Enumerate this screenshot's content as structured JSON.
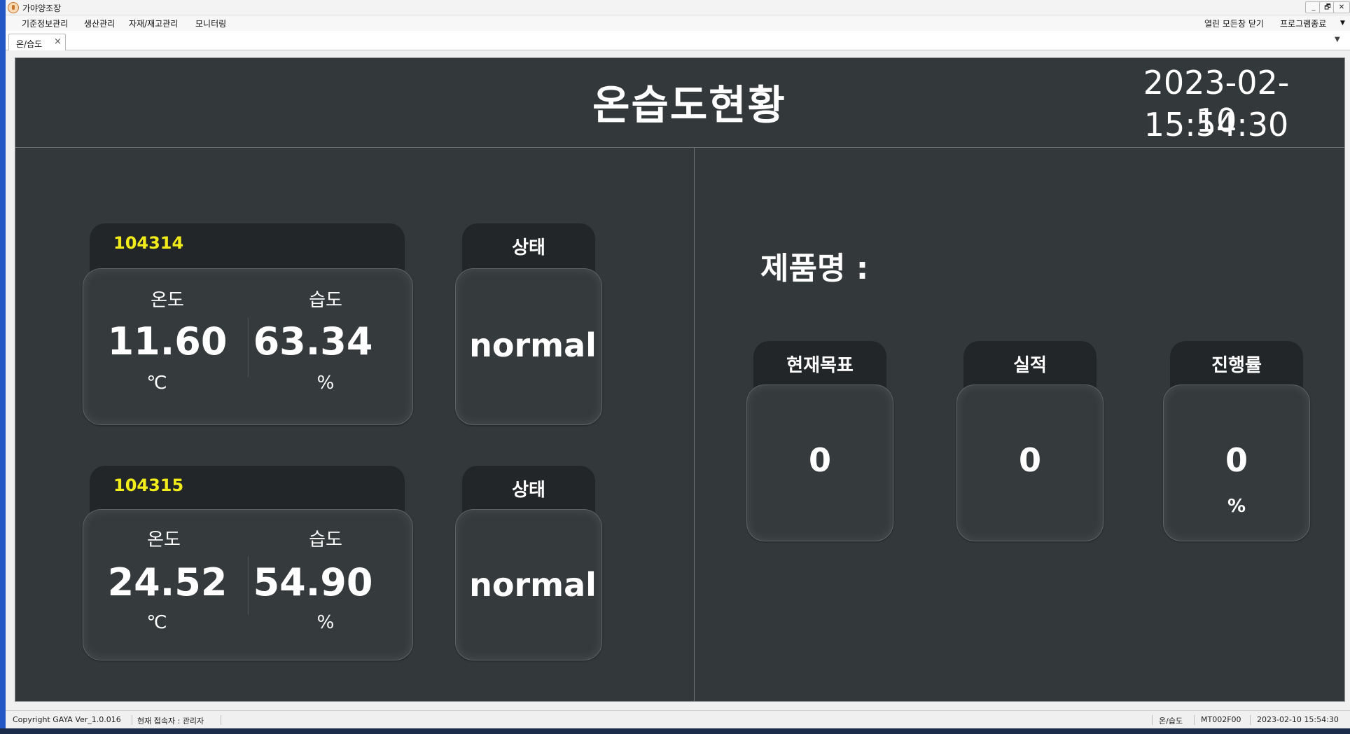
{
  "app": {
    "window_title": "가야양조장",
    "menu": [
      "기준정보관리",
      "생산관리",
      "자재/재고관리",
      "모니터링"
    ],
    "menu_right": [
      "열린 모든창 닫기",
      "프로그램종료"
    ],
    "window_buttons": [
      "_",
      "🗗",
      "✕"
    ]
  },
  "tab": {
    "label": "온/습도",
    "close": "×",
    "menu_arrow": "▼"
  },
  "dashboard": {
    "title": "온습도현황",
    "date": "2023-02-10",
    "time": "15:54:30"
  },
  "sensors": [
    {
      "id": "104314",
      "temp_label": "온도",
      "humidity_label": "습도",
      "temperature": "11.60",
      "humidity": "63.34",
      "temp_unit": "℃",
      "humidity_unit": "%",
      "status_label": "상태",
      "status": "normal"
    },
    {
      "id": "104315",
      "temp_label": "온도",
      "humidity_label": "습도",
      "temperature": "24.52",
      "humidity": "54.90",
      "temp_unit": "℃",
      "humidity_unit": "%",
      "status_label": "상태",
      "status": "normal"
    }
  ],
  "product": {
    "label": "제품명 :",
    "kpis": [
      {
        "label": "현재목표",
        "value": "0",
        "unit": ""
      },
      {
        "label": "실적",
        "value": "0",
        "unit": ""
      },
      {
        "label": "진행률",
        "value": "0",
        "unit": "%"
      }
    ]
  },
  "statusbar": {
    "copyright": "Copyright GAYA Ver_1.0.016",
    "user": "현재 접속자 : 관리자",
    "screen": "온/습도",
    "code": "MT002F00",
    "timestamp": "2023-02-10 15:54:30"
  }
}
